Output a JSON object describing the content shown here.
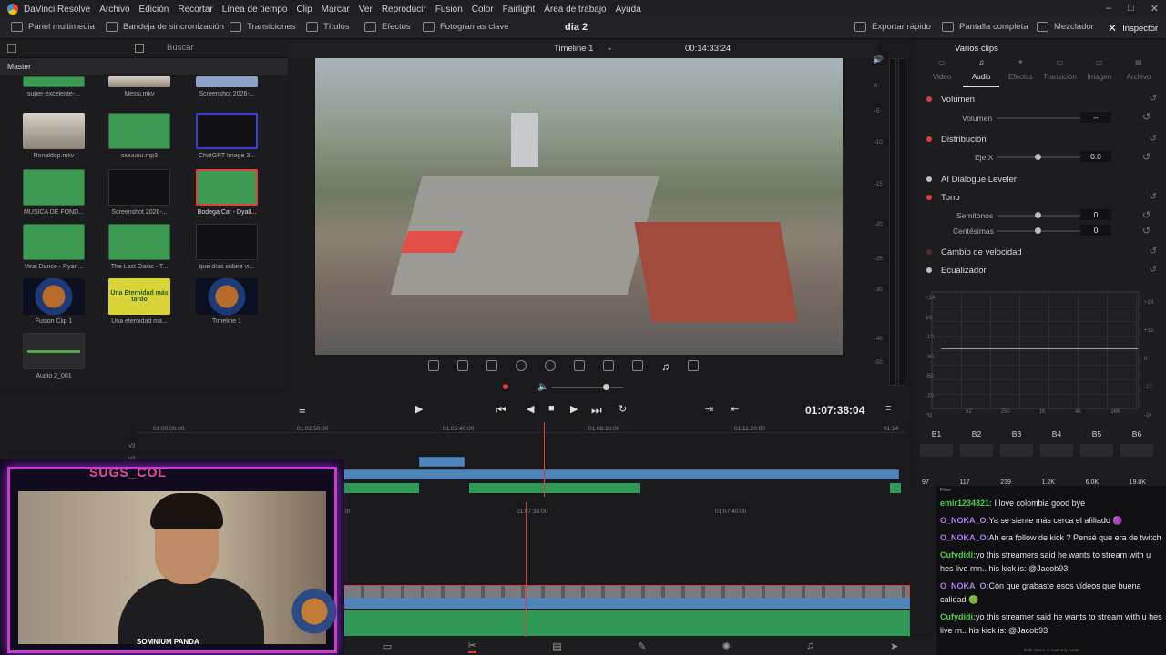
{
  "menu": {
    "app": "DaVinci Resolve",
    "items": [
      "Archivo",
      "Edición",
      "Recortar",
      "Línea de tiempo",
      "Clip",
      "Marcar",
      "Ver",
      "Reproducir",
      "Fusion",
      "Color",
      "Fairlight",
      "Área de trabajo",
      "Ayuda"
    ]
  },
  "window_controls": [
    "–",
    "□",
    "✕"
  ],
  "toolbar": {
    "media_panel": "Panel multimedia",
    "sync_bin": "Bandeja de sincronización",
    "transitions": "Transiciones",
    "titles": "Títulos",
    "effects": "Efectos",
    "keyframes": "Fotogramas clave",
    "project": "dia 2",
    "quick_export": "Exportar rápido",
    "fullscreen": "Pantalla completa",
    "mixer": "Mezclador",
    "inspector": "Inspector"
  },
  "media_pool": {
    "search_placeholder": "Buscar",
    "bin": "Master",
    "clips": [
      {
        "label": "super-excelente-..."
      },
      {
        "label": "Messi.mkv"
      },
      {
        "label": "Screenshot 2026-..."
      },
      {
        "label": "Ronaldop.mkv"
      },
      {
        "label": "siuuuuu.mp3"
      },
      {
        "label": "ChatGPT Image 3..."
      },
      {
        "label": "MUSICA DE FOND..."
      },
      {
        "label": "Screenshot 2026-..."
      },
      {
        "label": "Bodega Cat - Dyall..."
      },
      {
        "label": "Viral Dance - Ryan..."
      },
      {
        "label": "The Last Oasis - T..."
      },
      {
        "label": "que días subiré vi..."
      },
      {
        "label": "Fusion Clip 1"
      },
      {
        "label": "Una eternidad ma..."
      },
      {
        "label": "Timeline 1"
      },
      {
        "label": "Audio 2_001"
      }
    ],
    "yellow_thumb_text": "Una Eternidad más tardo"
  },
  "viewer": {
    "timeline_name": "Timeline 1",
    "source_timecode": "00:14:33:24",
    "playhead_timecode": "01:07:38:04"
  },
  "meter_scale": [
    "0",
    "-5",
    "-10",
    "-15",
    "-20",
    "-25",
    "-30",
    "-40",
    "-50"
  ],
  "inspector": {
    "header": "Varios clips",
    "tabs": [
      "Video",
      "Audio",
      "Efectos",
      "Transición",
      "Imagen",
      "Archivo"
    ],
    "active_tab": "Audio",
    "volume_section": "Volumen",
    "volume_label": "Volumen",
    "volume_value": "--",
    "distribution_section": "Distribución",
    "axis_label": "Eje X",
    "axis_value": "0.0",
    "ai_leveler": "AI Dialogue Leveler",
    "pitch_section": "Tono",
    "semitones_label": "Semitonos",
    "semitones_value": "0",
    "cents_label": "Centésimas",
    "cents_value": "0",
    "speed_change": "Cambio de velocidad",
    "equalizer": "Ecualizador",
    "eq_bands": [
      {
        "name": "B1",
        "value": "97"
      },
      {
        "name": "B2",
        "value": "117"
      },
      {
        "name": "B3",
        "value": "239"
      },
      {
        "name": "B4",
        "value": "1.2K"
      },
      {
        "name": "B5",
        "value": "6.0K"
      },
      {
        "name": "B6",
        "value": "19.0K"
      }
    ],
    "eq_left_db": [
      "+24",
      "10",
      "-10",
      "-30",
      "-50",
      "-70",
      "Hz"
    ],
    "eq_right_db": [
      "+24",
      "+12",
      "0",
      "-12",
      "-24"
    ],
    "eq_freq": [
      "62",
      "250",
      "1K",
      "4K",
      "16K"
    ]
  },
  "ruler_top": [
    "01:00:00:00",
    "01:02:50:00",
    "01:05:40:00",
    "01:08:30:00",
    "01:11:20:00",
    "01:14"
  ],
  "ruler_bottom": [
    "01:07:38:00",
    "01:07:40:00"
  ],
  "track_labels": [
    "V3",
    "V2"
  ],
  "stream": {
    "channel_name": "SUGS_COL",
    "sponsor": "SOMNIUM PANDA"
  },
  "chat": {
    "filter_label": "Filter",
    "messages": [
      {
        "user": "emir1234321:",
        "text": " I love colombia good bye",
        "color": "#49d04b"
      },
      {
        "user": "O_NOKA_O:",
        "text": "Ya se siente más cerca el afiliado 🟣",
        "color": "#b07cf0"
      },
      {
        "user": "O_NOKA_O:",
        "text": "Ah era follow de kick ? Pensé que era de twitch",
        "color": "#b07cf0"
      },
      {
        "user": "Cufydidi:",
        "text": "yo this streamers said he wants to stream with u hes live rnn.. his kick is: @Jacob93",
        "color": "#49d04b"
      },
      {
        "user": "O_NOKA_O:",
        "text": "Con que grabaste esos vídeos que buena calidad 🟢",
        "color": "#b07cf0"
      },
      {
        "user": "Cufydidi:",
        "text": "yo this streamer said he wants to stream with u hes live rn.. his kick is: @Jacob93",
        "color": "#49d04b"
      }
    ],
    "footer": "Multi chat is in read only mode"
  },
  "colors": {
    "accent_red": "#e23c3c",
    "video_clip": "#4f84b9",
    "audio_clip": "#2f9a56",
    "stream_frame": "#c53cd0"
  }
}
